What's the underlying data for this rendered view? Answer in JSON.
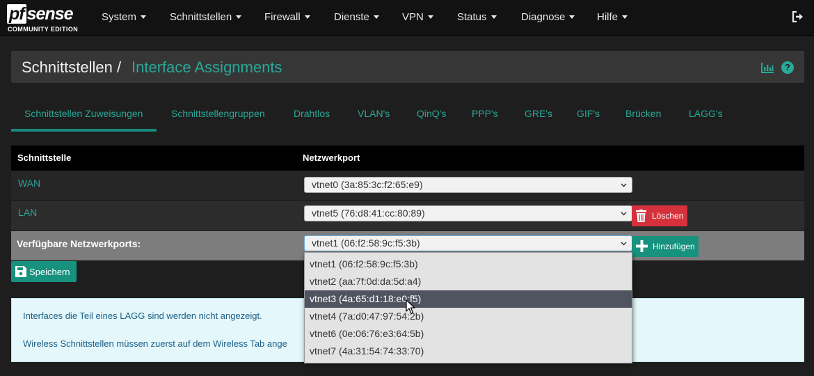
{
  "brand": {
    "logo_mark_a": "pf",
    "logo_mark_b": "sense",
    "logo_edition": "COMMUNITY EDITION"
  },
  "nav": {
    "items": [
      {
        "label": "System"
      },
      {
        "label": "Schnittstellen"
      },
      {
        "label": "Firewall"
      },
      {
        "label": "Dienste"
      },
      {
        "label": "VPN"
      },
      {
        "label": "Status"
      },
      {
        "label": "Diagnose"
      },
      {
        "label": "Hilfe"
      }
    ],
    "logout_icon": "logout-icon"
  },
  "breadcrumb": {
    "main": "Schnittstellen",
    "separator": "/",
    "sub": "Interface Assignments"
  },
  "header_icons": {
    "chart": "bar-chart-icon",
    "help": "question-circle-icon",
    "help_glyph": "?"
  },
  "tabs": [
    {
      "label": "Schnittstellen Zuweisungen",
      "active": true
    },
    {
      "label": "Schnittstellengruppen"
    },
    {
      "label": "Drahtlos"
    },
    {
      "label": "VLAN's"
    },
    {
      "label": "QinQ's"
    },
    {
      "label": "PPP's"
    },
    {
      "label": "GRE's"
    },
    {
      "label": "GIF's"
    },
    {
      "label": "Brücken"
    },
    {
      "label": "LAGG's"
    }
  ],
  "table": {
    "headers": {
      "interface": "Schnittstelle",
      "port": "Netzwerkport"
    },
    "rows": [
      {
        "interface": "WAN",
        "port": "vtnet0 (3a:85:3c:f2:65:e9)"
      },
      {
        "interface": "LAN",
        "port": "vtnet5 (76:d8:41:cc:80:89)",
        "delete_label": "Löschen"
      }
    ],
    "available": {
      "label": "Verfügbare Netzwerkports:",
      "selected": "vtnet1 (06:f2:58:9c:f5:3b)",
      "add_label": "Hinzufügen"
    }
  },
  "save_label": "Speichern",
  "info": {
    "line1": "Interfaces die Teil eines LAGG sind werden nicht angezeigt.",
    "line2": "Wireless Schnittstellen müssen zuerst auf dem Wireless Tab ange"
  },
  "dropdown": {
    "options": [
      {
        "label": "vtnet1 (06:f2:58:9c:f5:3b)"
      },
      {
        "label": "vtnet2 (aa:7f:0d:da:5d:a4)"
      },
      {
        "label": "vtnet3 (4a:65:d1:18:e0:f5)",
        "highlighted": true
      },
      {
        "label": "vtnet4 (7a:d0:47:97:54:2b)"
      },
      {
        "label": "vtnet6 (0e:06:76:e3:64:5b)"
      },
      {
        "label": "vtnet7 (4a:31:54:74:33:70)"
      }
    ]
  },
  "colors": {
    "accent": "#2aa898",
    "danger": "#d5313c",
    "button": "#17927f",
    "highlight": "#505460",
    "info_bg": "#e4f7fb",
    "info_text": "#1a5f86"
  }
}
